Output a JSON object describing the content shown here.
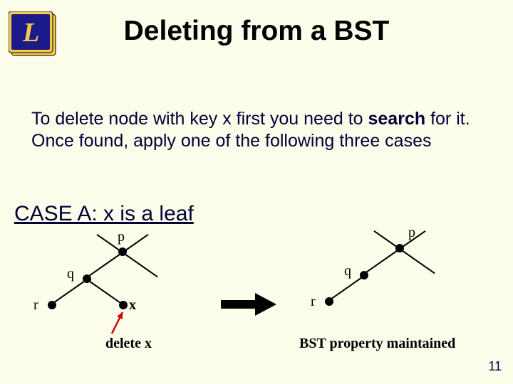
{
  "title": "Deleting from a BST",
  "intro": {
    "part1": "To delete node with key x first you need to ",
    "bold": "search",
    "part2": " for it. Once found, apply one of the following three cases"
  },
  "case_heading": "CASE A: x is a leaf",
  "labels": {
    "p": "p",
    "q": "q",
    "r": "r",
    "x": "x"
  },
  "captions": {
    "delete_x": "delete x",
    "maintained": "BST property maintained"
  },
  "page_number": "11"
}
